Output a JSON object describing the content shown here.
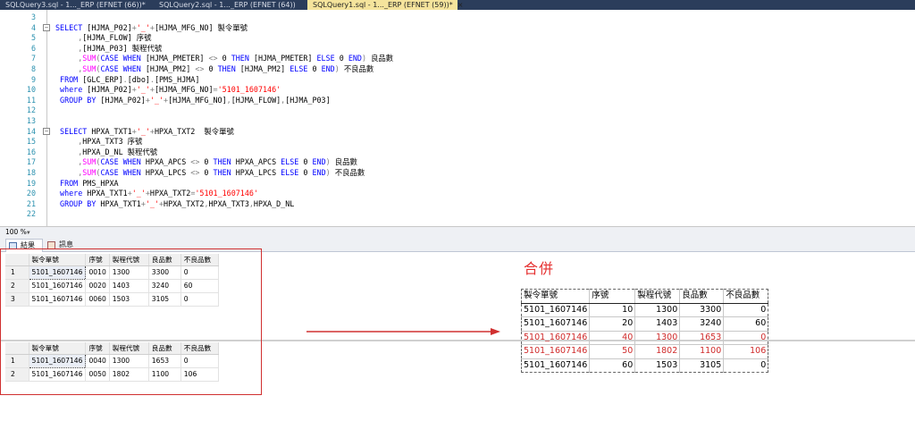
{
  "tabs": [
    {
      "label": "SQLQuery3.sql - 1..._ERP (EFNET (66))*"
    },
    {
      "label": "SQLQuery2.sql - 1..._ERP (EFNET (64))"
    },
    {
      "label": "SQLQuery1.sql - 1..._ERP (EFNET (59))*",
      "close": "×"
    }
  ],
  "editor": {
    "lines": [
      {
        "n": "3",
        "fold": "",
        "segs": [
          {
            "t": "",
            "c": "blk"
          }
        ]
      },
      {
        "n": "4",
        "fold": "−",
        "segs": [
          {
            "t": "SELECT ",
            "c": "kw"
          },
          {
            "t": "[HJMA_P02]",
            "c": "blk"
          },
          {
            "t": "+",
            "c": "gry"
          },
          {
            "t": "'_'",
            "c": "str"
          },
          {
            "t": "+",
            "c": "gry"
          },
          {
            "t": "[HJMA_MFG_NO] 製令單號",
            "c": "blk"
          }
        ]
      },
      {
        "n": "5",
        "fold": "",
        "segs": [
          {
            "t": "     ,",
            "c": "gry"
          },
          {
            "t": "[HJMA_FLOW] 序號",
            "c": "blk"
          }
        ]
      },
      {
        "n": "6",
        "fold": "",
        "segs": [
          {
            "t": "     ,",
            "c": "gry"
          },
          {
            "t": "[HJMA_P03] 製程代號",
            "c": "blk"
          }
        ]
      },
      {
        "n": "7",
        "fold": "",
        "segs": [
          {
            "t": "     ,",
            "c": "gry"
          },
          {
            "t": "SUM",
            "c": "fn"
          },
          {
            "t": "(",
            "c": "gry"
          },
          {
            "t": "CASE WHEN ",
            "c": "kw"
          },
          {
            "t": "[HJMA_PMETER] ",
            "c": "blk"
          },
          {
            "t": "<>",
            "c": "gry"
          },
          {
            "t": " 0 ",
            "c": "blk"
          },
          {
            "t": "THEN ",
            "c": "kw"
          },
          {
            "t": "[HJMA_PMETER] ",
            "c": "blk"
          },
          {
            "t": "ELSE ",
            "c": "kw"
          },
          {
            "t": "0 ",
            "c": "blk"
          },
          {
            "t": "END",
            "c": "kw"
          },
          {
            "t": ") ",
            "c": "gry"
          },
          {
            "t": "良品數",
            "c": "blk"
          }
        ]
      },
      {
        "n": "8",
        "fold": "",
        "segs": [
          {
            "t": "     ,",
            "c": "gry"
          },
          {
            "t": "SUM",
            "c": "fn"
          },
          {
            "t": "(",
            "c": "gry"
          },
          {
            "t": "CASE WHEN ",
            "c": "kw"
          },
          {
            "t": "[HJMA_PM2] ",
            "c": "blk"
          },
          {
            "t": "<>",
            "c": "gry"
          },
          {
            "t": " 0 ",
            "c": "blk"
          },
          {
            "t": "THEN ",
            "c": "kw"
          },
          {
            "t": "[HJMA_PM2] ",
            "c": "blk"
          },
          {
            "t": "ELSE ",
            "c": "kw"
          },
          {
            "t": "0 ",
            "c": "blk"
          },
          {
            "t": "END",
            "c": "kw"
          },
          {
            "t": ") ",
            "c": "gry"
          },
          {
            "t": "不良品數",
            "c": "blk"
          }
        ]
      },
      {
        "n": "9",
        "fold": "",
        "segs": [
          {
            "t": " FROM ",
            "c": "kw"
          },
          {
            "t": "[GLC_ERP]",
            "c": "blk"
          },
          {
            "t": ".",
            "c": "gry"
          },
          {
            "t": "[dbo]",
            "c": "blk"
          },
          {
            "t": ".",
            "c": "gry"
          },
          {
            "t": "[PMS_HJMA]",
            "c": "blk"
          }
        ]
      },
      {
        "n": "10",
        "fold": "",
        "segs": [
          {
            "t": " where ",
            "c": "kw"
          },
          {
            "t": "[HJMA_P02]",
            "c": "blk"
          },
          {
            "t": "+",
            "c": "gry"
          },
          {
            "t": "'_'",
            "c": "str"
          },
          {
            "t": "+",
            "c": "gry"
          },
          {
            "t": "[HJMA_MFG_NO]",
            "c": "blk"
          },
          {
            "t": "=",
            "c": "gry"
          },
          {
            "t": "'5101_1607146'",
            "c": "str"
          }
        ]
      },
      {
        "n": "11",
        "fold": "",
        "segs": [
          {
            "t": " GROUP BY ",
            "c": "kw"
          },
          {
            "t": "[HJMA_P02]",
            "c": "blk"
          },
          {
            "t": "+",
            "c": "gry"
          },
          {
            "t": "'_'",
            "c": "str"
          },
          {
            "t": "+",
            "c": "gry"
          },
          {
            "t": "[HJMA_MFG_NO]",
            "c": "blk"
          },
          {
            "t": ",",
            "c": "gry"
          },
          {
            "t": "[HJMA_FLOW]",
            "c": "blk"
          },
          {
            "t": ",",
            "c": "gry"
          },
          {
            "t": "[HJMA_P03]",
            "c": "blk"
          }
        ]
      },
      {
        "n": "12",
        "fold": "",
        "segs": [
          {
            "t": "",
            "c": "blk"
          }
        ]
      },
      {
        "n": "13",
        "fold": "",
        "segs": [
          {
            "t": "",
            "c": "blk"
          }
        ]
      },
      {
        "n": "14",
        "fold": "−",
        "segs": [
          {
            "t": " SELECT ",
            "c": "kw"
          },
          {
            "t": "HPXA_TXT1",
            "c": "blk"
          },
          {
            "t": "+",
            "c": "gry"
          },
          {
            "t": "'_'",
            "c": "str"
          },
          {
            "t": "+",
            "c": "gry"
          },
          {
            "t": "HPXA_TXT2  製令單號",
            "c": "blk"
          }
        ]
      },
      {
        "n": "15",
        "fold": "",
        "segs": [
          {
            "t": "     ,",
            "c": "gry"
          },
          {
            "t": "HPXA_TXT3 序號",
            "c": "blk"
          }
        ]
      },
      {
        "n": "16",
        "fold": "",
        "segs": [
          {
            "t": "     ,",
            "c": "gry"
          },
          {
            "t": "HPXA_D_NL 製程代號",
            "c": "blk"
          }
        ]
      },
      {
        "n": "17",
        "fold": "",
        "segs": [
          {
            "t": "     ,",
            "c": "gry"
          },
          {
            "t": "SUM",
            "c": "fn"
          },
          {
            "t": "(",
            "c": "gry"
          },
          {
            "t": "CASE WHEN ",
            "c": "kw"
          },
          {
            "t": "HPXA_APCS ",
            "c": "blk"
          },
          {
            "t": "<>",
            "c": "gry"
          },
          {
            "t": " 0 ",
            "c": "blk"
          },
          {
            "t": "THEN ",
            "c": "kw"
          },
          {
            "t": "HPXA_APCS ",
            "c": "blk"
          },
          {
            "t": "ELSE ",
            "c": "kw"
          },
          {
            "t": "0 ",
            "c": "blk"
          },
          {
            "t": "END",
            "c": "kw"
          },
          {
            "t": ") ",
            "c": "gry"
          },
          {
            "t": "良品數",
            "c": "blk"
          }
        ]
      },
      {
        "n": "18",
        "fold": "",
        "segs": [
          {
            "t": "     ,",
            "c": "gry"
          },
          {
            "t": "SUM",
            "c": "fn"
          },
          {
            "t": "(",
            "c": "gry"
          },
          {
            "t": "CASE WHEN ",
            "c": "kw"
          },
          {
            "t": "HPXA_LPCS ",
            "c": "blk"
          },
          {
            "t": "<>",
            "c": "gry"
          },
          {
            "t": " 0 ",
            "c": "blk"
          },
          {
            "t": "THEN ",
            "c": "kw"
          },
          {
            "t": "HPXA_LPCS ",
            "c": "blk"
          },
          {
            "t": "ELSE ",
            "c": "kw"
          },
          {
            "t": "0 ",
            "c": "blk"
          },
          {
            "t": "END",
            "c": "kw"
          },
          {
            "t": ") ",
            "c": "gry"
          },
          {
            "t": "不良品數",
            "c": "blk"
          }
        ]
      },
      {
        "n": "19",
        "fold": "",
        "segs": [
          {
            "t": " FROM ",
            "c": "kw"
          },
          {
            "t": "PMS_HPXA",
            "c": "blk"
          }
        ]
      },
      {
        "n": "20",
        "fold": "",
        "segs": [
          {
            "t": " where ",
            "c": "kw"
          },
          {
            "t": "HPXA_TXT1",
            "c": "blk"
          },
          {
            "t": "+",
            "c": "gry"
          },
          {
            "t": "'_'",
            "c": "str"
          },
          {
            "t": "+",
            "c": "gry"
          },
          {
            "t": "HPXA_TXT2",
            "c": "blk"
          },
          {
            "t": "=",
            "c": "gry"
          },
          {
            "t": "'5101_1607146'",
            "c": "str"
          }
        ]
      },
      {
        "n": "21",
        "fold": "",
        "segs": [
          {
            "t": " GROUP BY ",
            "c": "kw"
          },
          {
            "t": "HPXA_TXT1",
            "c": "blk"
          },
          {
            "t": "+",
            "c": "gry"
          },
          {
            "t": "'_'",
            "c": "str"
          },
          {
            "t": "+",
            "c": "gry"
          },
          {
            "t": "HPXA_TXT2",
            "c": "blk"
          },
          {
            "t": ",",
            "c": "gry"
          },
          {
            "t": "HPXA_TXT3",
            "c": "blk"
          },
          {
            "t": ",",
            "c": "gry"
          },
          {
            "t": "HPXA_D_NL",
            "c": "blk"
          }
        ]
      },
      {
        "n": "22",
        "fold": "",
        "segs": [
          {
            "t": "",
            "c": "blk"
          }
        ]
      }
    ]
  },
  "status": {
    "zoom": "100 %"
  },
  "result_tabs": [
    {
      "label": "結果"
    },
    {
      "label": "訊息"
    }
  ],
  "grid_headers": [
    "製令單號",
    "序號",
    "製程代號",
    "良品數",
    "不良品數"
  ],
  "grid1": {
    "rows": [
      {
        "n": "1",
        "cells": [
          "5101_1607146",
          "0010",
          "1300",
          "3300",
          "0"
        ]
      },
      {
        "n": "2",
        "cells": [
          "5101_1607146",
          "0020",
          "1403",
          "3240",
          "60"
        ]
      },
      {
        "n": "3",
        "cells": [
          "5101_1607146",
          "0060",
          "1503",
          "3105",
          "0"
        ]
      }
    ]
  },
  "grid2": {
    "rows": [
      {
        "n": "1",
        "cells": [
          "5101_1607146",
          "0040",
          "1300",
          "1653",
          "0"
        ]
      },
      {
        "n": "2",
        "cells": [
          "5101_1607146",
          "0050",
          "1802",
          "1100",
          "106"
        ]
      }
    ]
  },
  "merge": {
    "title": "合併",
    "headers": [
      "製令單號",
      "序號",
      "製程代號",
      "良品數",
      "不良品數"
    ],
    "rows": [
      {
        "cells": [
          "5101_1607146",
          "10",
          "1300",
          "3300",
          "0"
        ],
        "highlight": false
      },
      {
        "cells": [
          "5101_1607146",
          "20",
          "1403",
          "3240",
          "60"
        ],
        "highlight": false
      },
      {
        "cells": [
          "5101_1607146",
          "40",
          "1300",
          "1653",
          "0"
        ],
        "highlight": true
      },
      {
        "cells": [
          "5101_1607146",
          "50",
          "1802",
          "1100",
          "106"
        ],
        "highlight": true
      },
      {
        "cells": [
          "5101_1607146",
          "60",
          "1503",
          "3105",
          "0"
        ],
        "highlight": false
      }
    ]
  },
  "colors": {
    "accent_red": "#d03030",
    "keyword_blue": "#0000ff",
    "function_magenta": "#ff00ff",
    "string_red": "#ff0000",
    "tab_active": "#f5e49c"
  }
}
